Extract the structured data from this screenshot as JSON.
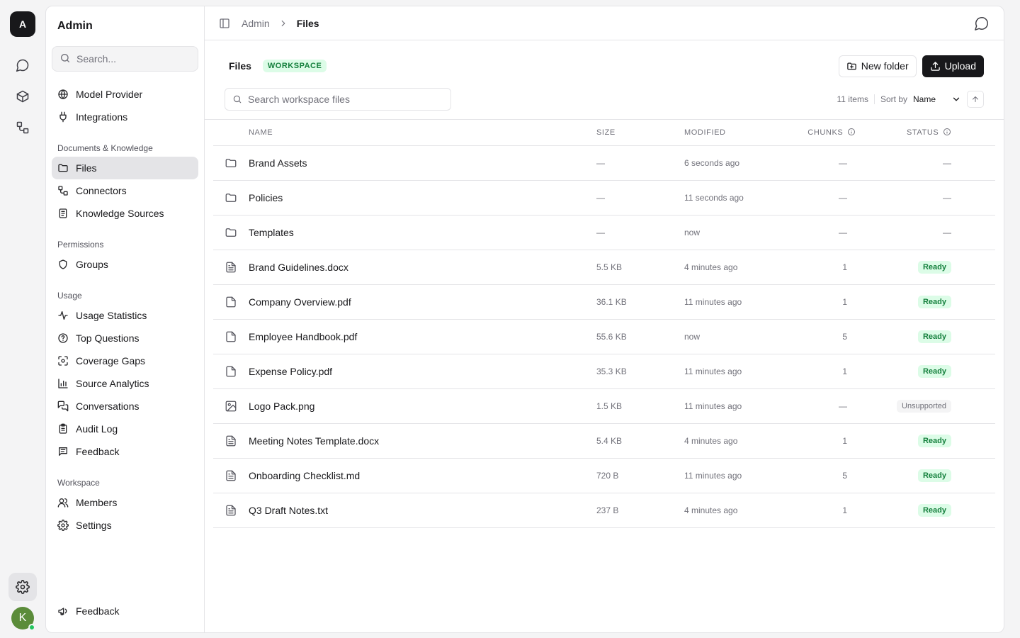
{
  "rail": {
    "logo": "A",
    "avatar": "K",
    "icons": [
      "chat-icon",
      "cube-icon",
      "connectors-icon"
    ],
    "bottom_icon": "gear-icon"
  },
  "sidebar": {
    "title": "Admin",
    "search_placeholder": "Search...",
    "top_items": [
      {
        "label": "Model Provider",
        "icon": "globe-icon"
      },
      {
        "label": "Integrations",
        "icon": "plug-icon"
      }
    ],
    "groups": [
      {
        "heading": "Documents & Knowledge",
        "items": [
          {
            "label": "Files",
            "icon": "folder-icon",
            "active": true
          },
          {
            "label": "Connectors",
            "icon": "connectors-icon"
          },
          {
            "label": "Knowledge Sources",
            "icon": "book-icon"
          }
        ]
      },
      {
        "heading": "Permissions",
        "items": [
          {
            "label": "Groups",
            "icon": "shield-icon"
          }
        ]
      },
      {
        "heading": "Usage",
        "items": [
          {
            "label": "Usage Statistics",
            "icon": "activity-icon"
          },
          {
            "label": "Top Questions",
            "icon": "question-icon"
          },
          {
            "label": "Coverage Gaps",
            "icon": "scan-icon"
          },
          {
            "label": "Source Analytics",
            "icon": "bar-chart-icon"
          },
          {
            "label": "Conversations",
            "icon": "chat-icon"
          },
          {
            "label": "Audit Log",
            "icon": "clipboard-icon"
          },
          {
            "label": "Feedback",
            "icon": "message-square-icon"
          }
        ]
      },
      {
        "heading": "Workspace",
        "items": [
          {
            "label": "Members",
            "icon": "users-icon"
          },
          {
            "label": "Settings",
            "icon": "gear-icon"
          }
        ]
      }
    ],
    "footer_item": {
      "label": "Feedback",
      "icon": "megaphone-icon"
    }
  },
  "topbar": {
    "crumb_root": "Admin",
    "crumb_current": "Files"
  },
  "header": {
    "title": "Files",
    "badge": "WORKSPACE",
    "new_folder_label": "New folder",
    "upload_label": "Upload"
  },
  "filters": {
    "search_placeholder": "Search workspace files",
    "count": "11 items",
    "sort_by_label": "Sort by",
    "sort_value": "Name"
  },
  "table": {
    "headers": {
      "name": "NAME",
      "size": "SIZE",
      "modified": "MODIFIED",
      "chunks": "CHUNKS",
      "status": "STATUS"
    },
    "rows": [
      {
        "type": "folder",
        "name": "Brand Assets",
        "size": "—",
        "modified": "6 seconds ago",
        "chunks": "—",
        "status": "—"
      },
      {
        "type": "folder",
        "name": "Policies",
        "size": "—",
        "modified": "11 seconds ago",
        "chunks": "—",
        "status": "—"
      },
      {
        "type": "folder",
        "name": "Templates",
        "size": "—",
        "modified": "now",
        "chunks": "—",
        "status": "—"
      },
      {
        "type": "doc",
        "name": "Brand Guidelines.docx",
        "size": "5.5 KB",
        "modified": "4 minutes ago",
        "chunks": "1",
        "status": "Ready"
      },
      {
        "type": "file",
        "name": "Company Overview.pdf",
        "size": "36.1 KB",
        "modified": "11 minutes ago",
        "chunks": "1",
        "status": "Ready"
      },
      {
        "type": "file",
        "name": "Employee Handbook.pdf",
        "size": "55.6 KB",
        "modified": "now",
        "chunks": "5",
        "status": "Ready"
      },
      {
        "type": "file",
        "name": "Expense Policy.pdf",
        "size": "35.3 KB",
        "modified": "11 minutes ago",
        "chunks": "1",
        "status": "Ready"
      },
      {
        "type": "image",
        "name": "Logo Pack.png",
        "size": "1.5 KB",
        "modified": "11 minutes ago",
        "chunks": "—",
        "status": "Unsupported"
      },
      {
        "type": "doc",
        "name": "Meeting Notes Template.docx",
        "size": "5.4 KB",
        "modified": "4 minutes ago",
        "chunks": "1",
        "status": "Ready"
      },
      {
        "type": "doc",
        "name": "Onboarding Checklist.md",
        "size": "720 B",
        "modified": "11 minutes ago",
        "chunks": "5",
        "status": "Ready"
      },
      {
        "type": "doc",
        "name": "Q3 Draft Notes.txt",
        "size": "237 B",
        "modified": "4 minutes ago",
        "chunks": "1",
        "status": "Ready"
      }
    ]
  },
  "colors": {
    "ready_fg": "#15803d",
    "ready_bg": "#dcfce7",
    "accent": "#18181b"
  }
}
